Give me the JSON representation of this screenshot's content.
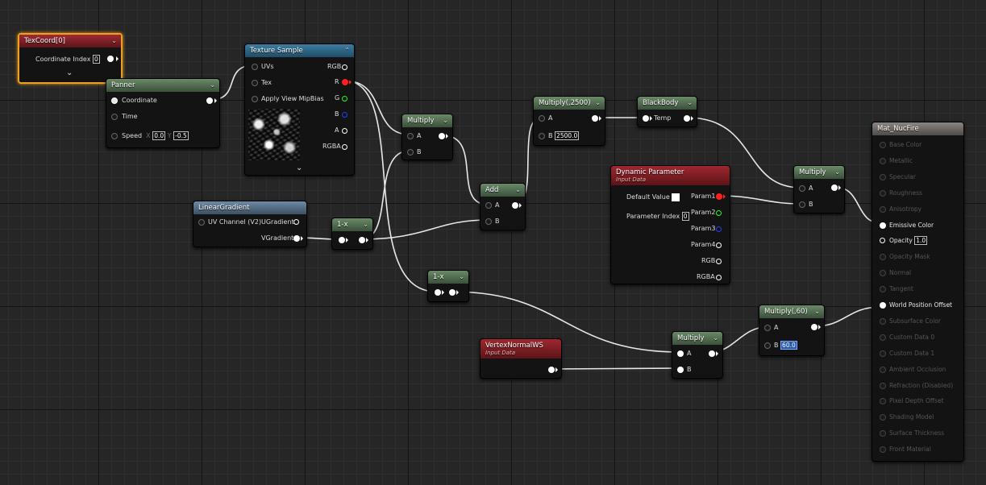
{
  "nodes": {
    "texcoord": {
      "title": "TexCoord[0]",
      "rows": [
        "Coordinate Index"
      ],
      "index_value": "0"
    },
    "panner": {
      "title": "Panner",
      "coordinate": "Coordinate",
      "time": "Time",
      "speed": "Speed",
      "x_label": "X",
      "x_value": "0.0",
      "y_label": "Y",
      "y_value": "-0.5"
    },
    "texture_sample": {
      "title": "Texture Sample",
      "inputs": [
        "UVs",
        "Tex",
        "Apply View MipBias"
      ],
      "outputs": [
        "RGB",
        "R",
        "G",
        "B",
        "A",
        "RGBA"
      ]
    },
    "linear_gradient": {
      "title": "LinearGradient",
      "rows": [
        "UV Channel (V2)",
        "UGradient",
        "VGradient"
      ]
    },
    "one_minus_1": {
      "title": "1-x"
    },
    "one_minus_2": {
      "title": "1-x"
    },
    "multiply_1": {
      "title": "Multiply",
      "a": "A",
      "b": "B"
    },
    "add": {
      "title": "Add",
      "a": "A",
      "b": "B"
    },
    "multiply_2500": {
      "title": "Multiply(,2500)",
      "a": "A",
      "b": "B",
      "b_value": "2500.0"
    },
    "blackbody": {
      "title": "BlackBody",
      "temp": "Temp"
    },
    "dynamic_parameter": {
      "title": "Dynamic Parameter",
      "subtitle": "Input Data",
      "default_value": "Default Value",
      "parameter_index": "Parameter Index",
      "index_value": "0",
      "outputs": [
        "Param1",
        "Param2",
        "Param3",
        "Param4",
        "RGB",
        "RGBA"
      ]
    },
    "multiply_final": {
      "title": "Multiply",
      "a": "A",
      "b": "B"
    },
    "vertex_normal": {
      "title": "VertexNormalWS",
      "subtitle": "Input Data"
    },
    "multiply_vn": {
      "title": "Multiply",
      "a": "A",
      "b": "B"
    },
    "multiply_60": {
      "title": "Multiply(,60)",
      "a": "A",
      "b": "B",
      "b_value": "60.0"
    },
    "material": {
      "title": "Mat_NucFire",
      "pins": [
        "Base Color",
        "Metallic",
        "Specular",
        "Roughness",
        "Anisotropy",
        "Emissive Color",
        "Opacity",
        "Opacity Mask",
        "Normal",
        "Tangent",
        "World Position Offset",
        "Subsurface Color",
        "Custom Data 0",
        "Custom Data 1",
        "Ambient Occlusion",
        "Refraction (Disabled)",
        "Pixel Depth Offset",
        "Shading Model",
        "Surface Thickness",
        "Front Material"
      ],
      "opacity_value": "1.0"
    }
  },
  "colors": {
    "pin_red": "#ff2020",
    "pin_green": "#20ff20",
    "pin_blue": "#2040ff",
    "selection": "#f0a020"
  },
  "icons": {
    "chevron": "chevron-down-icon"
  }
}
